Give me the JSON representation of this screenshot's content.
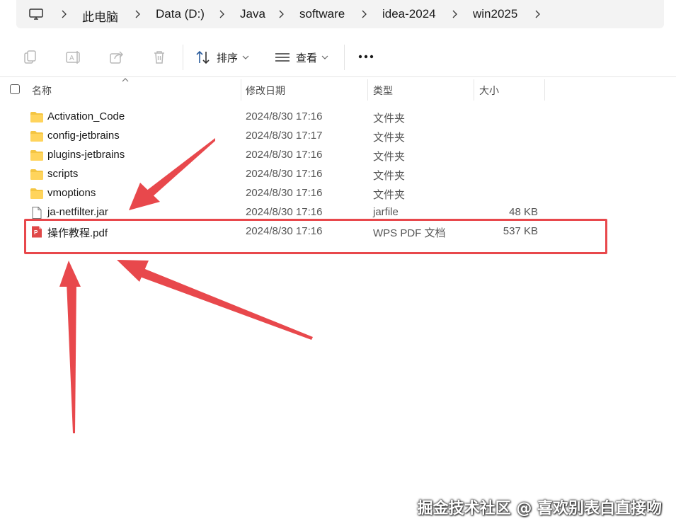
{
  "breadcrumb": [
    "此电脑",
    "Data (D:)",
    "Java",
    "software",
    "idea-2024",
    "win2025"
  ],
  "toolbar": {
    "sort_label": "排序",
    "view_label": "查看",
    "more_label": "..."
  },
  "columns": {
    "name": "名称",
    "modified": "修改日期",
    "type": "类型",
    "size": "大小"
  },
  "files": [
    {
      "name": "Activation_Code",
      "modified": "2024/8/30 17:16",
      "type": "文件夹",
      "size": "",
      "icon": "folder-icon"
    },
    {
      "name": "config-jetbrains",
      "modified": "2024/8/30 17:17",
      "type": "文件夹",
      "size": "",
      "icon": "folder-icon"
    },
    {
      "name": "plugins-jetbrains",
      "modified": "2024/8/30 17:16",
      "type": "文件夹",
      "size": "",
      "icon": "folder-icon"
    },
    {
      "name": "scripts",
      "modified": "2024/8/30 17:16",
      "type": "文件夹",
      "size": "",
      "icon": "folder-icon"
    },
    {
      "name": "vmoptions",
      "modified": "2024/8/30 17:16",
      "type": "文件夹",
      "size": "",
      "icon": "folder-icon"
    },
    {
      "name": "ja-netfilter.jar",
      "modified": "2024/8/30 17:16",
      "type": "jarfile",
      "size": "48 KB",
      "icon": "file-icon"
    },
    {
      "name": "操作教程.pdf",
      "modified": "2024/8/30 17:16",
      "type": "WPS PDF 文档",
      "size": "537 KB",
      "icon": "pdf-icon"
    }
  ],
  "colors": {
    "annotation": "#e8484c",
    "folder": "#f4c542",
    "pdf": "#e04848"
  },
  "watermark": "掘金技术社区 @ 喜欢别表白直接吻"
}
